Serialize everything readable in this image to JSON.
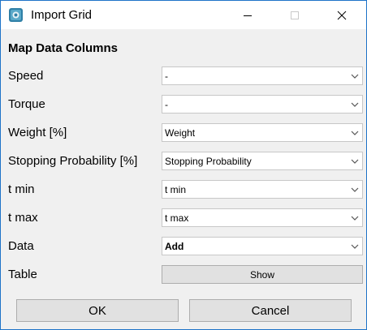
{
  "window": {
    "title": "Import Grid"
  },
  "heading": "Map Data Columns",
  "rows": [
    {
      "label": "Speed",
      "value": "-"
    },
    {
      "label": "Torque",
      "value": "-"
    },
    {
      "label": "Weight [%]",
      "value": "Weight"
    },
    {
      "label": "Stopping Probability [%]",
      "value": "Stopping Probability"
    },
    {
      "label": "t min",
      "value": "t min"
    },
    {
      "label": "t max",
      "value": "t max"
    },
    {
      "label": "Data",
      "value": "Add"
    }
  ],
  "table": {
    "label": "Table",
    "button": "Show"
  },
  "buttons": {
    "ok": "OK",
    "cancel": "Cancel"
  },
  "icons": {
    "app": "import-grid-icon",
    "minimize": "minimize-icon",
    "maximize": "maximize-icon",
    "close": "close-icon",
    "dropdown": "chevron-down-icon"
  },
  "colors": {
    "window_border": "#1e73c8",
    "background": "#f0f0f0",
    "button": "#e1e1e1"
  }
}
